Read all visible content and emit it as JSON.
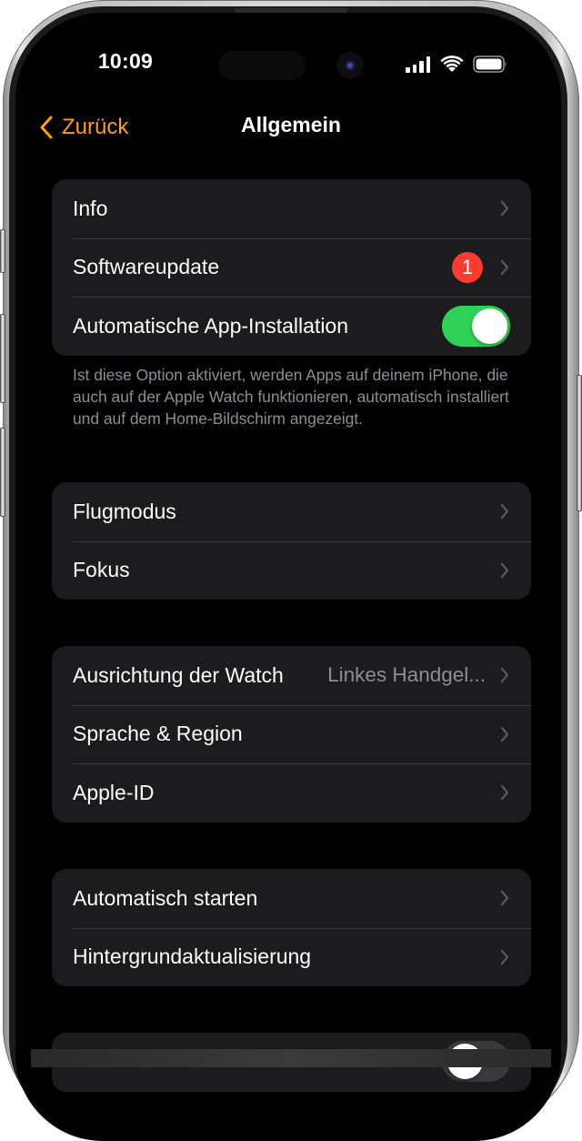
{
  "status_bar": {
    "time": "10:09",
    "icons": [
      "cellular-signal-icon",
      "wifi-icon",
      "battery-icon"
    ]
  },
  "nav": {
    "back_label": "Zurück",
    "back_icon": "chevron-left-icon",
    "title": "Allgemein",
    "accent_color": "#ff9f0a"
  },
  "groups": [
    {
      "rows": [
        {
          "label": "Info",
          "accessory": "chevron"
        },
        {
          "label": "Softwareupdate",
          "badge": "1",
          "accessory": "chevron"
        },
        {
          "label": "Automatische App-Installation",
          "accessory": "toggle",
          "toggle_on": true
        }
      ],
      "footer": "Ist diese Option aktiviert, werden Apps auf deinem iPhone, die auch auf der Apple Watch funktionieren, automatisch installiert und auf dem Home-Bildschirm angezeigt."
    },
    {
      "rows": [
        {
          "label": "Flugmodus",
          "accessory": "chevron"
        },
        {
          "label": "Fokus",
          "accessory": "chevron"
        }
      ]
    },
    {
      "rows": [
        {
          "label": "Ausrichtung der Watch",
          "value": "Linkes Handgel...",
          "accessory": "chevron"
        },
        {
          "label": "Sprache & Region",
          "accessory": "chevron"
        },
        {
          "label": "Apple-ID",
          "accessory": "chevron"
        }
      ]
    },
    {
      "rows": [
        {
          "label": "Automatisch starten",
          "accessory": "chevron"
        },
        {
          "label": "Hintergrundaktualisierung",
          "accessory": "chevron"
        }
      ]
    },
    {
      "rows": [
        {
          "label": "",
          "accessory": "toggle",
          "toggle_on": false
        }
      ]
    }
  ],
  "colors": {
    "toggle_on": "#30d158",
    "badge": "#ff3b30",
    "cell_background": "#1c1c1e",
    "secondary_text": "#8e8e93"
  }
}
